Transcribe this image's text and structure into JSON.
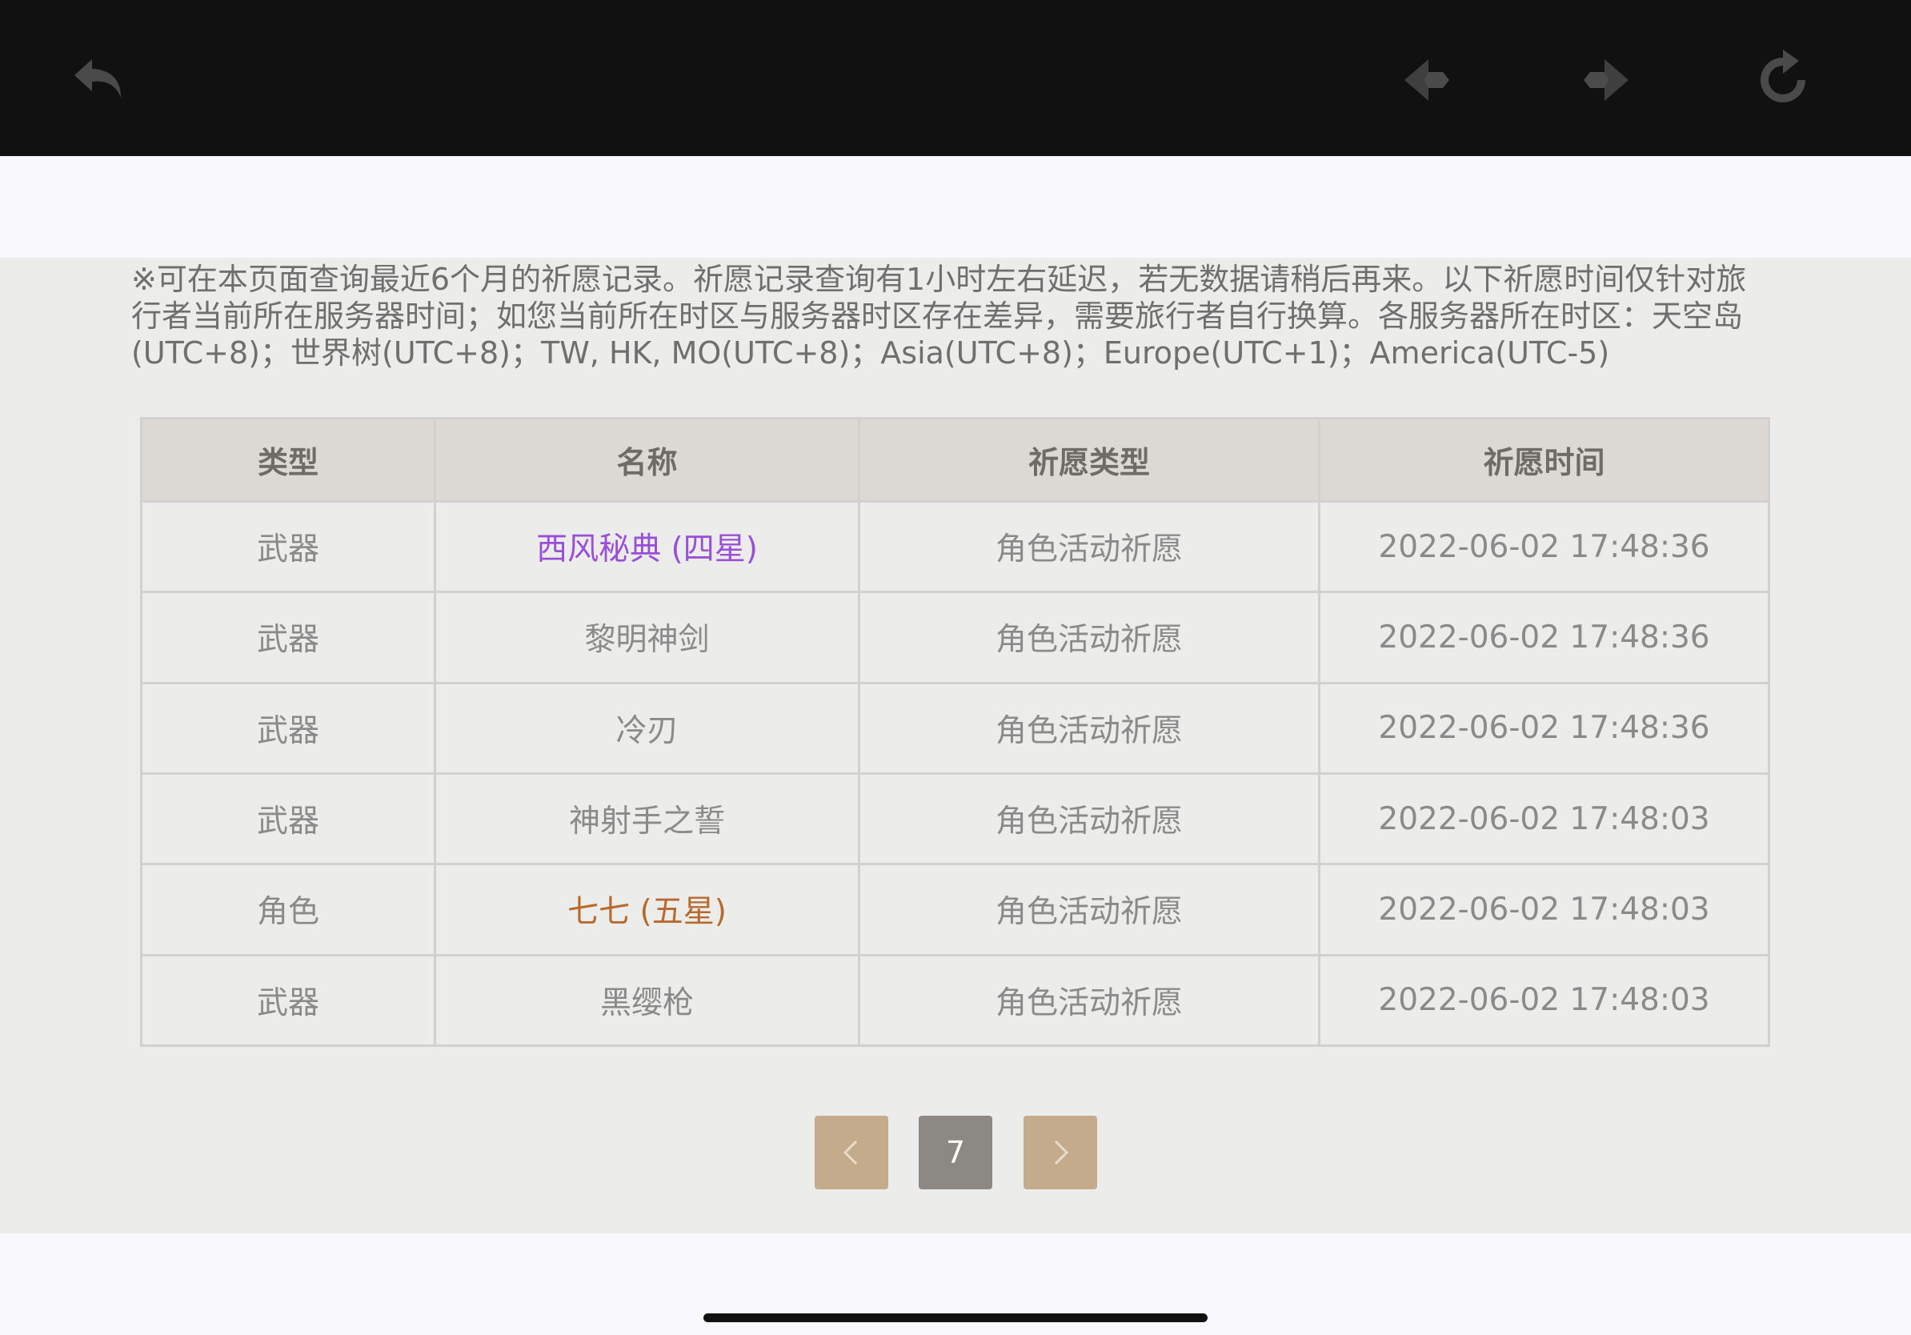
{
  "toolbar": {
    "back_icon": "undo-arrow-icon",
    "prev_icon": "diamond-left-icon",
    "next_icon": "diamond-right-icon",
    "refresh_icon": "refresh-icon"
  },
  "notice": "※可在本页面查询最近6个月的祈愿记录。祈愿记录查询有1小时左右延迟，若无数据请稍后再来。以下祈愿时间仅针对旅行者当前所在服务器时间；如您当前所在时区与服务器时区存在差异，需要旅行者自行换算。各服务器所在时区：天空岛(UTC+8)；世界树(UTC+8)；TW, HK, MO(UTC+8)；Asia(UTC+8)；Europe(UTC+1)；America(UTC-5)",
  "table": {
    "headers": [
      "类型",
      "名称",
      "祈愿类型",
      "祈愿时间"
    ],
    "rows": [
      {
        "type": "武器",
        "name": "西风秘典 (四星)",
        "wish_type": "角色活动祈愿",
        "time": "2022-06-02 17:48:36",
        "rarity": "four"
      },
      {
        "type": "武器",
        "name": "黎明神剑",
        "wish_type": "角色活动祈愿",
        "time": "2022-06-02 17:48:36",
        "rarity": "three"
      },
      {
        "type": "武器",
        "name": "冷刃",
        "wish_type": "角色活动祈愿",
        "time": "2022-06-02 17:48:36",
        "rarity": "three"
      },
      {
        "type": "武器",
        "name": "神射手之誓",
        "wish_type": "角色活动祈愿",
        "time": "2022-06-02 17:48:03",
        "rarity": "three"
      },
      {
        "type": "角色",
        "name": "七七 (五星)",
        "wish_type": "角色活动祈愿",
        "time": "2022-06-02 17:48:03",
        "rarity": "five"
      },
      {
        "type": "武器",
        "name": "黑缨枪",
        "wish_type": "角色活动祈愿",
        "time": "2022-06-02 17:48:03",
        "rarity": "three"
      }
    ]
  },
  "pagination": {
    "current_page": "7",
    "prev_icon": "chevron-left-icon",
    "next_icon": "chevron-right-icon"
  },
  "colors": {
    "four_star": "#9a4fd8",
    "five_star": "#b86a2e",
    "pager_accent": "#c4ab8b",
    "pager_current": "#8c8883"
  }
}
